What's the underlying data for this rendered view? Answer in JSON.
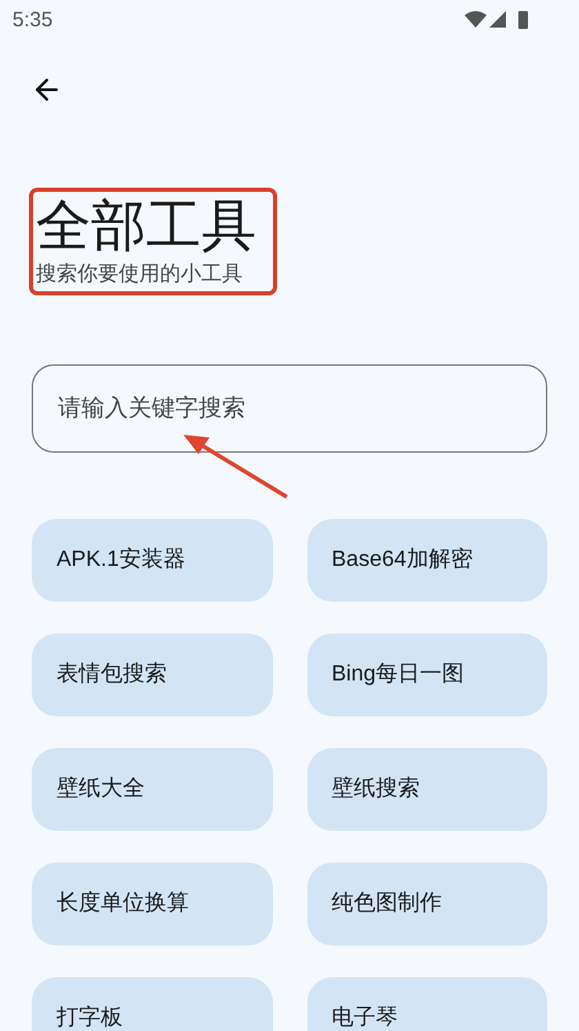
{
  "status_bar": {
    "time": "5:35"
  },
  "header": {
    "title": "全部工具",
    "subtitle": "搜索你要使用的小工具"
  },
  "search": {
    "placeholder": "请输入关键字搜索"
  },
  "tools": [
    {
      "label": "APK.1安装器"
    },
    {
      "label": "Base64加解密"
    },
    {
      "label": "表情包搜索"
    },
    {
      "label": "Bing每日一图"
    },
    {
      "label": "壁纸大全"
    },
    {
      "label": "壁纸搜索"
    },
    {
      "label": "长度单位换算"
    },
    {
      "label": "纯色图制作"
    },
    {
      "label": "打字板"
    },
    {
      "label": "电子琴"
    }
  ]
}
